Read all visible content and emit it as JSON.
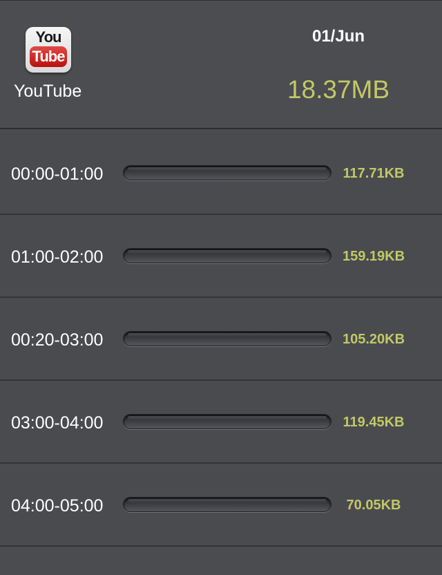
{
  "header": {
    "app_icon": "youtube-app-icon",
    "icon_text_top": "You",
    "icon_text_bottom": "Tube",
    "app_name": "YouTube",
    "date": "01/Jun",
    "total": "18.37MB"
  },
  "colors": {
    "background": "#4b4c50",
    "accent": "#c3c866",
    "text": "#ffffff"
  },
  "rows": [
    {
      "time": "00:00-01:00",
      "amount": "117.71KB"
    },
    {
      "time": "01:00-02:00",
      "amount": "159.19KB"
    },
    {
      "time": "00:20-03:00",
      "amount": "105.20KB"
    },
    {
      "time": "03:00-04:00",
      "amount": "119.45KB"
    },
    {
      "time": "04:00-05:00",
      "amount": "70.05KB"
    }
  ]
}
